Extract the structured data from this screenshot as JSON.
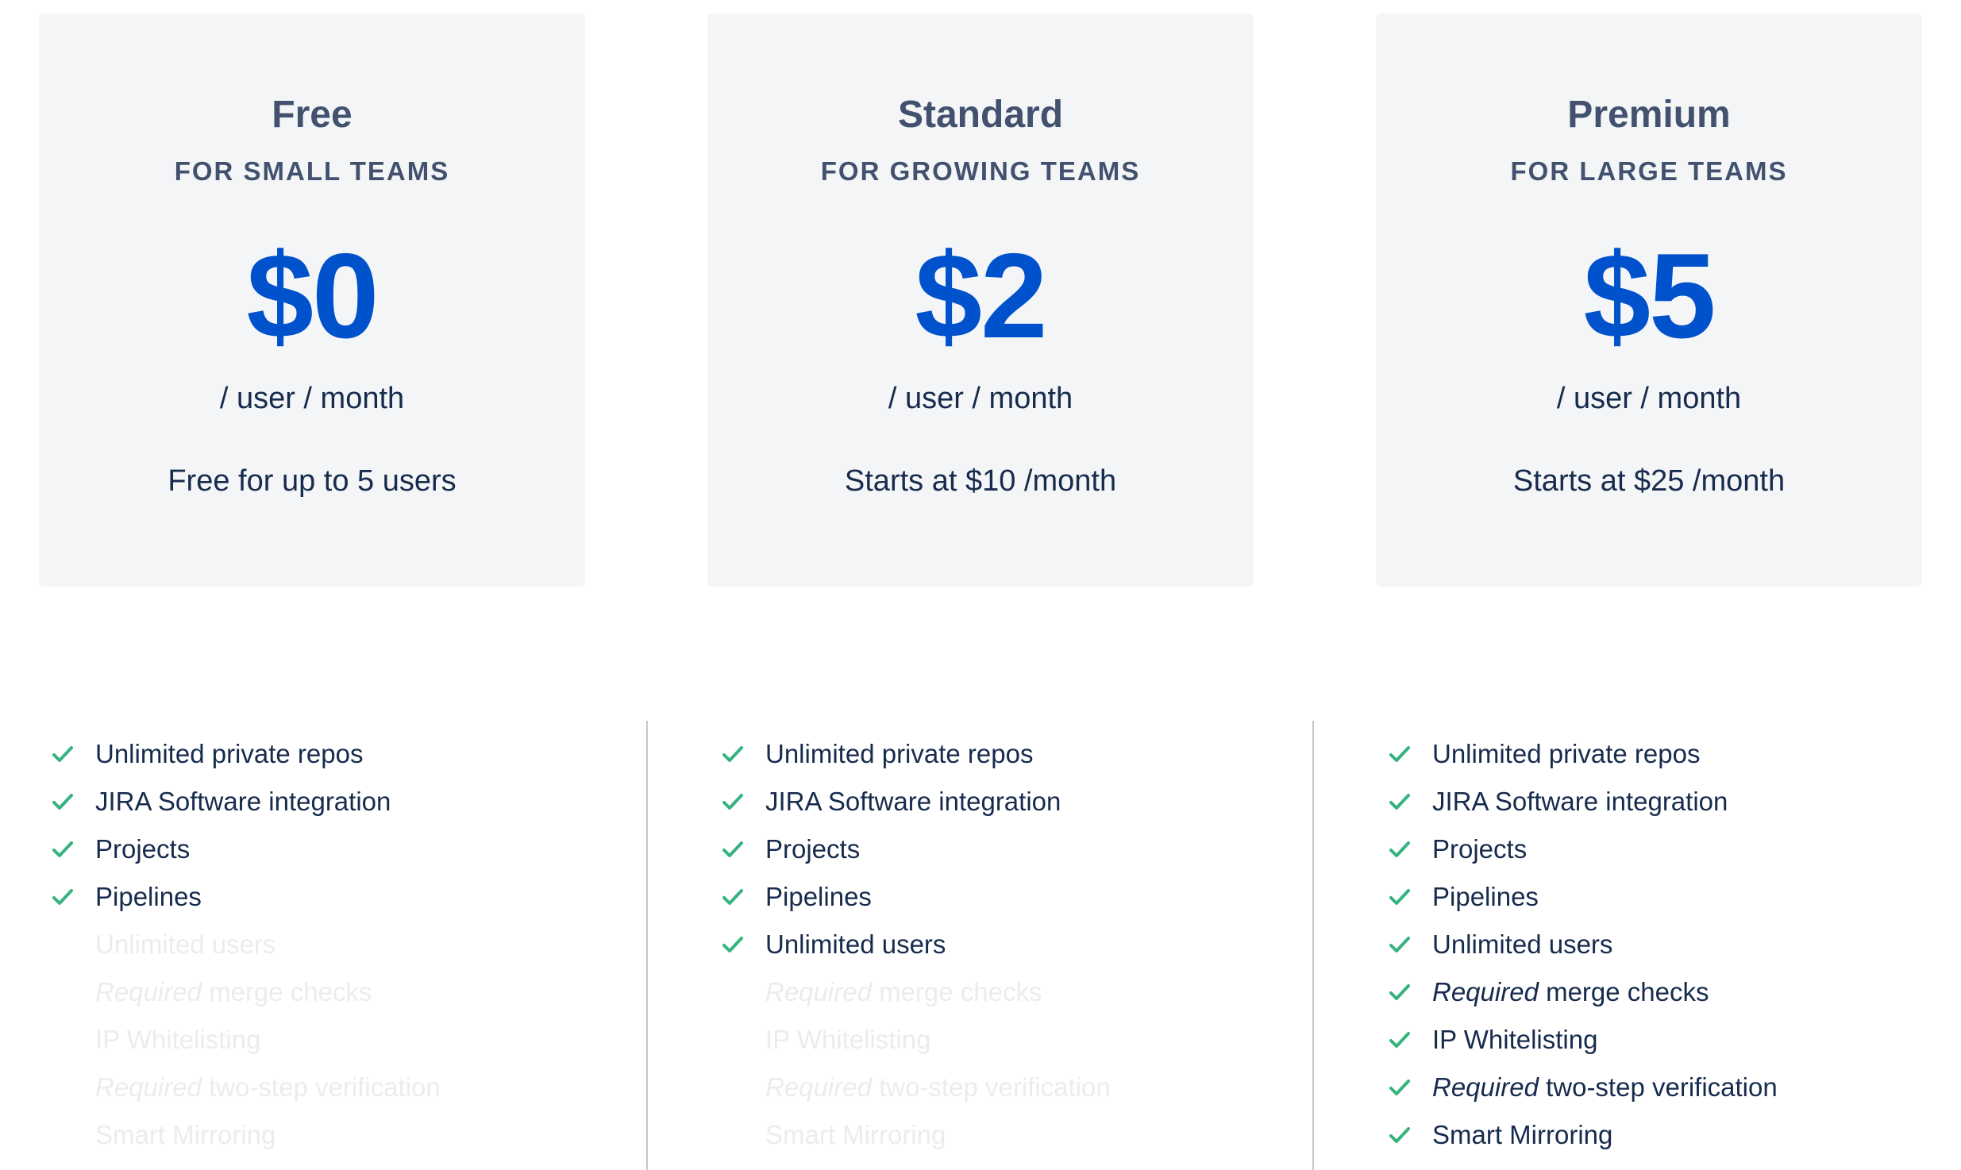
{
  "colors": {
    "card_background": "#f4f5f7",
    "price": "#0052cc",
    "heading": "#42526e",
    "text": "#172b4d",
    "check": "#36b37e",
    "disabled_text": "#ebecf0"
  },
  "plans": [
    {
      "name": "Free",
      "subtitle": "FOR SMALL TEAMS",
      "price": "$0",
      "per": "/ user / month",
      "note": "Free for up to 5 users",
      "features": [
        {
          "prefix": "",
          "label": "Unlimited private repos",
          "included": true
        },
        {
          "prefix": "",
          "label": "JIRA Software integration",
          "included": true
        },
        {
          "prefix": "",
          "label": "Projects",
          "included": true
        },
        {
          "prefix": "",
          "label": "Pipelines",
          "included": true
        },
        {
          "prefix": "",
          "label": "Unlimited users",
          "included": false
        },
        {
          "prefix": "Required",
          "label": " merge checks",
          "included": false
        },
        {
          "prefix": "",
          "label": "IP Whitelisting",
          "included": false
        },
        {
          "prefix": "Required",
          "label": " two-step verification",
          "included": false
        },
        {
          "prefix": "",
          "label": "Smart Mirroring",
          "included": false
        }
      ]
    },
    {
      "name": "Standard",
      "subtitle": "FOR GROWING TEAMS",
      "price": "$2",
      "per": "/ user / month",
      "note": "Starts at $10 /month",
      "features": [
        {
          "prefix": "",
          "label": "Unlimited private repos",
          "included": true
        },
        {
          "prefix": "",
          "label": "JIRA Software integration",
          "included": true
        },
        {
          "prefix": "",
          "label": "Projects",
          "included": true
        },
        {
          "prefix": "",
          "label": "Pipelines",
          "included": true
        },
        {
          "prefix": "",
          "label": "Unlimited users",
          "included": true
        },
        {
          "prefix": "Required",
          "label": " merge checks",
          "included": false
        },
        {
          "prefix": "",
          "label": "IP Whitelisting",
          "included": false
        },
        {
          "prefix": "Required",
          "label": " two-step verification",
          "included": false
        },
        {
          "prefix": "",
          "label": "Smart Mirroring",
          "included": false
        }
      ]
    },
    {
      "name": "Premium",
      "subtitle": "FOR LARGE TEAMS",
      "price": "$5",
      "per": "/ user / month",
      "note": "Starts at $25 /month",
      "features": [
        {
          "prefix": "",
          "label": "Unlimited private repos",
          "included": true
        },
        {
          "prefix": "",
          "label": "JIRA Software integration",
          "included": true
        },
        {
          "prefix": "",
          "label": "Projects",
          "included": true
        },
        {
          "prefix": "",
          "label": "Pipelines",
          "included": true
        },
        {
          "prefix": "",
          "label": "Unlimited users",
          "included": true
        },
        {
          "prefix": "Required",
          "label": " merge checks",
          "included": true
        },
        {
          "prefix": "",
          "label": "IP Whitelisting",
          "included": true
        },
        {
          "prefix": "Required",
          "label": " two-step verification",
          "included": true
        },
        {
          "prefix": "",
          "label": "Smart Mirroring",
          "included": true
        }
      ]
    }
  ]
}
